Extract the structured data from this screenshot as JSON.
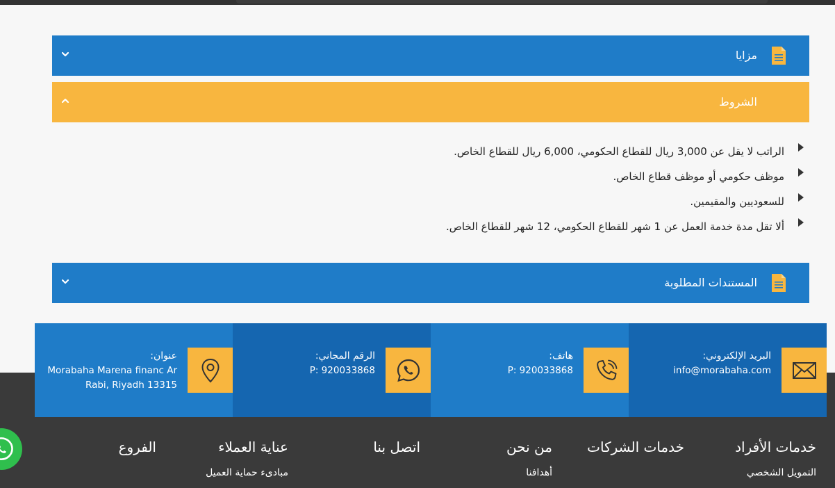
{
  "accordion": {
    "advantages_title": "مزايا",
    "terms_title": "الشروط",
    "documents_title": "المستندات المطلوبة",
    "terms_items": [
      "الراتب لا يقل عن 3,000 ريال للقطاع الحكومي، 6,000 ريال للقطاع الخاص.",
      "موظف حكومي أو موظف قطاع الخاص.",
      "للسعوديين والمقيمين.",
      "ألا تقل مدة خدمة العمل عن 1 شهر للقطاع الحكومي، 12 شهر للقطاع الخاص."
    ]
  },
  "contact": {
    "address_label": "عنوان:",
    "address_line1": "Morabaha Marena financ Ar",
    "address_line2": "Rabi, Riyadh 13315",
    "tollfree_label": "الرقم المجاني:",
    "tollfree_value": "P: 920033868",
    "phone_label": "هاتف:",
    "phone_value": "P: 920033868",
    "email_label": "البريد الإلكتروني:",
    "email_value": "info@morabaha.com"
  },
  "footer": {
    "col_individuals": "خدمات الأفراد",
    "col_individuals_link": "التمويل الشخصي",
    "col_companies": "خدمات الشركات",
    "col_about": "من نحن",
    "col_about_link": "أهدافنا",
    "col_contact": "اتصل بنا",
    "col_care": "عناية العملاء",
    "col_care_link": "مبادىء حماية العميل",
    "col_branches": "الفروع"
  },
  "colors": {
    "blue": "#1f7cc8",
    "dark_blue": "#1566b0",
    "yellow": "#f8b63f",
    "footer_dark": "#3a3a3a"
  },
  "icons": [
    "document-icon",
    "chevron-down-icon",
    "chevron-up-icon",
    "envelope-icon",
    "phone-icon",
    "whatsapp-icon",
    "location-pin-icon"
  ]
}
